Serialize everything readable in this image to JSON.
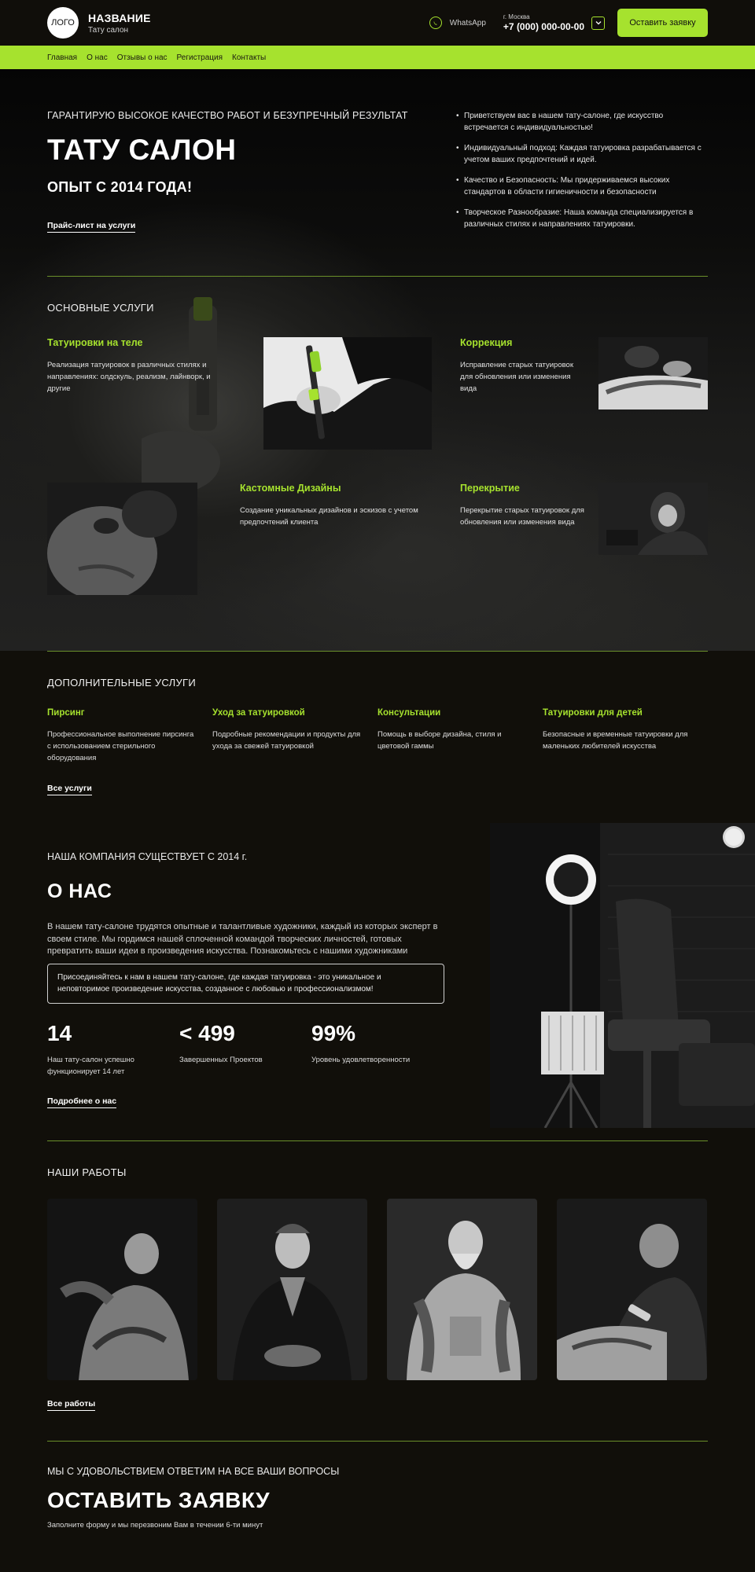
{
  "header": {
    "logo_text": "ЛОГО",
    "brand_name": "НАЗВАНИЕ",
    "brand_sub": "Тату салон",
    "whatsapp_label": "WhatsApp",
    "city": "г. Москва",
    "phone": "+7 (000) 000-00-00",
    "cta_label": "Оставить заявку"
  },
  "nav": {
    "items": [
      "Главная",
      "О нас",
      "Отзывы о нас",
      "Регистрация",
      "Контакты"
    ]
  },
  "hero": {
    "kicker": "ГАРАНТИРУЮ ВЫСОКОЕ КАЧЕСТВО РАБОТ И БЕЗУПРЕЧНЫЙ РЕЗУЛЬТАТ",
    "title": "ТАТУ САЛОН",
    "subtitle": "ОПЫТ С 2014 ГОДА!",
    "link": "Прайс-лист на услуги",
    "bullets": [
      "Приветствуем вас в нашем тату-салоне, где искусство встречается с индивидуальностью!",
      "Индивидуальный подход: Каждая татуировка разрабатывается с учетом ваших предпочтений и идей.",
      "Качество и Безопасность: Мы придерживаемся высоких стандартов в области гигиеничности и безопасности",
      "Творческое Разнообразие: Наша команда специализируется в различных стилях и направлениях татуировки."
    ]
  },
  "main_services": {
    "title": "ОСНОВНЫЕ УСЛУГИ",
    "items": [
      {
        "title": "Татуировки на теле",
        "text": "Реализация татуировок в различных стилях и направлениях: олдскуль, реализм, лайнворк, и другие"
      },
      {
        "title": "Коррекция",
        "text": "Исправление старых татуировок для обновления или изменения вида"
      },
      {
        "title": "Кастомные Дизайны",
        "text": "Создание уникальных дизайнов и эскизов с учетом предпочтений клиента"
      },
      {
        "title": "Перекрытие",
        "text": "Перекрытие старых татуировок для обновления или изменения вида"
      }
    ]
  },
  "additional_services": {
    "title": "ДОПОЛНИТЕЛЬНЫЕ УСЛУГИ",
    "items": [
      {
        "title": "Пирсинг",
        "text": "Профессиональное выполнение пирсинга с использованием стерильного оборудования"
      },
      {
        "title": "Уход за татуировкой",
        "text": "Подробные рекомендации и продукты для ухода за свежей татуировкой"
      },
      {
        "title": "Консультации",
        "text": "Помощь в выборе дизайна, стиля и цветовой гаммы"
      },
      {
        "title": "Татуировки для детей",
        "text": "Безопасные и временные татуировки для маленьких любителей искусства"
      }
    ],
    "link": "Все услуги"
  },
  "about": {
    "kicker": "НАША КОМПАНИЯ СУЩЕСТВУЕТ С 2014 г.",
    "title": "О НАС",
    "text": "В нашем тату-салоне трудятся опытные и талантливые художники, каждый из которых эксперт в своем стиле. Мы гордимся нашей сплоченной командой творческих личностей, готовых превратить ваши идеи в произведения искусства. Познакомьтесь с нашими художниками",
    "box_text": "Присоединяйтесь к нам в нашем тату-салоне, где каждая татуировка - это уникальное и неповторимое произведение искусства, созданное с любовью и профессионализмом!",
    "stats": [
      {
        "num": "14",
        "label": "Наш тату-салон успешно функционирует  14 лет"
      },
      {
        "num": "< 499",
        "label": "Завершенных Проектов"
      },
      {
        "num": "99%",
        "label": "Уровень удовлетворенности"
      }
    ],
    "link": "Подробнее  о нас"
  },
  "works": {
    "title": "НАШИ РАБОТЫ",
    "link": "Все работы"
  },
  "form": {
    "kicker": "МЫ С УДОВОЛЬСТВИЕМ ОТВЕТИМ НА ВСЕ ВАШИ ВОПРОСЫ",
    "title": "ОСТАВИТЬ ЗАЯВКУ",
    "subtitle": "Заполните форму и мы перезвоним Вам в течении 6-ти минут"
  },
  "colors": {
    "accent": "#a6e22e",
    "background": "#110f0a"
  }
}
